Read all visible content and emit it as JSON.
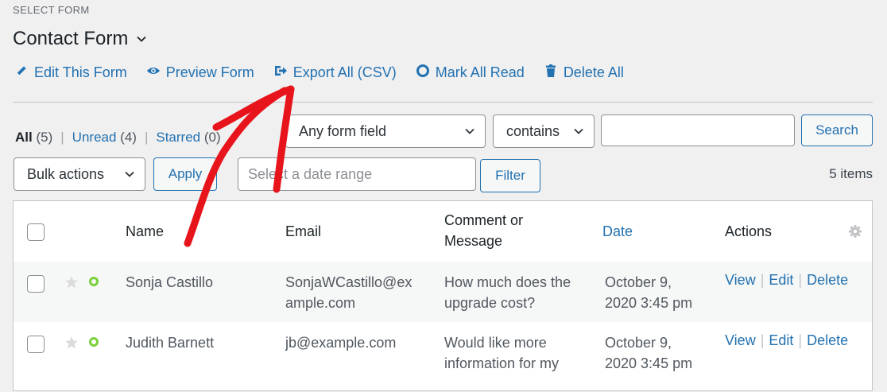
{
  "header": {
    "select_label": "SELECT FORM",
    "form_title": "Contact Form"
  },
  "actions": {
    "edit": "Edit This Form",
    "preview": "Preview Form",
    "export": "Export All (CSV)",
    "mark_read": "Mark All Read",
    "delete_all": "Delete All"
  },
  "status": {
    "all_label": "All",
    "all_count": "(5)",
    "unread_label": "Unread",
    "unread_count": "(4)",
    "starred_label": "Starred",
    "starred_count": "(0)"
  },
  "search": {
    "field_select": "Any form field",
    "operator_select": "contains",
    "query_value": "",
    "button": "Search"
  },
  "bulk": {
    "select": "Bulk actions",
    "apply": "Apply",
    "date_placeholder": "Select a date range",
    "filter": "Filter",
    "items_count": "5 items"
  },
  "table": {
    "columns": {
      "name": "Name",
      "email": "Email",
      "comment_line1": "Comment or",
      "comment_line2": "Message",
      "date": "Date",
      "actions": "Actions"
    },
    "rows": [
      {
        "name": "Sonja Castillo",
        "email_line1": "SonjaWCastillo@ex",
        "email_line2": "ample.com",
        "comment_line1": "How much does the",
        "comment_line2": "upgrade cost?",
        "date_line1": "October 9,",
        "date_line2": "2020 3:45 pm"
      },
      {
        "name": "Judith Barnett",
        "email_line1": "jb@example.com",
        "email_line2": "",
        "comment_line1": "Would like more",
        "comment_line2": "information for my",
        "date_line1": "October 9,",
        "date_line2": "2020 3:45 pm"
      }
    ],
    "row_actions": {
      "view": "View",
      "edit": "Edit",
      "delete": "Delete"
    }
  },
  "colors": {
    "link": "#2271b1",
    "read_dot": "#7ad03a",
    "annotation_arrow": "#e8141b"
  },
  "icons": {
    "title_dropdown": "chevron-down-icon",
    "edit": "pencil-icon",
    "preview": "eye-icon",
    "export": "export-icon",
    "mark_read": "circle-icon",
    "delete": "trash-icon",
    "star": "star-icon",
    "settings": "gear-icon"
  }
}
